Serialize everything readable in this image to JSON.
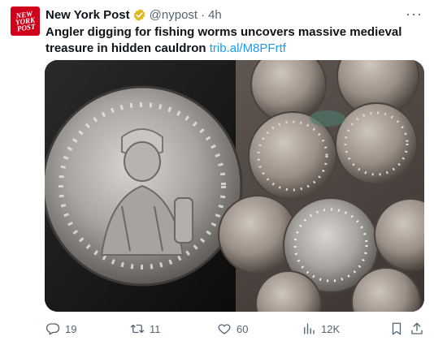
{
  "author": {
    "name": "New York Post",
    "handle": "@nypost",
    "separator": "·",
    "time": "4h",
    "avatar_lines": [
      "NEW",
      "YORK",
      "POST"
    ],
    "verified_color": "#e2b719"
  },
  "more_label": "···",
  "tweet": {
    "text": "Angler digging for fishing worms uncovers massive medieval treasure in hidden cauldron",
    "link": "trib.al/M8PFrtf"
  },
  "media": {
    "icon": "photo-of-silver-coins"
  },
  "actions": {
    "reply": {
      "count": "19",
      "icon": "reply-icon"
    },
    "retweet": {
      "count": "11",
      "icon": "retweet-icon"
    },
    "like": {
      "count": "60",
      "icon": "heart-icon"
    },
    "views": {
      "count": "12K",
      "icon": "views-icon"
    },
    "bookmark": {
      "icon": "bookmark-icon"
    },
    "share": {
      "icon": "share-icon"
    }
  },
  "colors": {
    "link": "#1d9bf0",
    "muted": "#536471",
    "avatar_bg": "#d0021b"
  }
}
